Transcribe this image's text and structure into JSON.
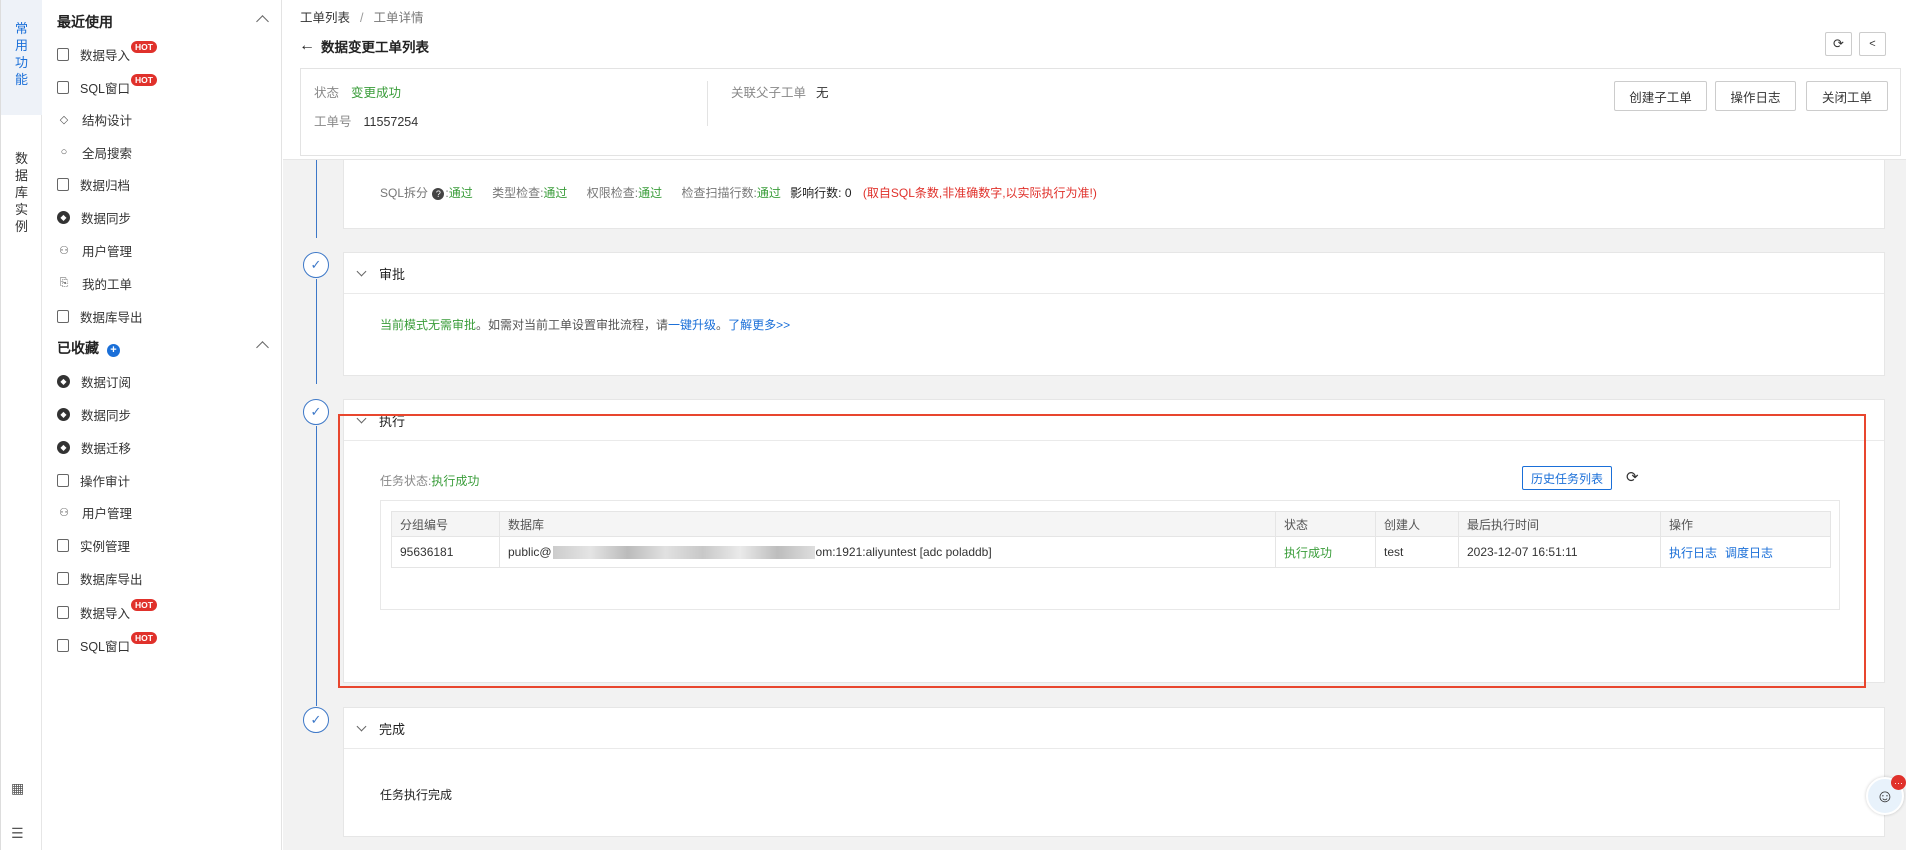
{
  "rail": {
    "active_tab": [
      "常",
      "用",
      "功",
      "能"
    ],
    "second_tab": [
      "数",
      "据",
      "库",
      "实",
      "例"
    ]
  },
  "menu": {
    "recent_title": "最近使用",
    "recent_items": [
      {
        "label": "数据导入",
        "hot": "HOT"
      },
      {
        "label": "SQL窗口",
        "hot": "HOT"
      },
      {
        "label": "结构设计"
      },
      {
        "label": "全局搜索"
      },
      {
        "label": "数据归档"
      },
      {
        "label": "数据同步"
      },
      {
        "label": "用户管理"
      },
      {
        "label": "我的工单"
      },
      {
        "label": "数据库导出"
      }
    ],
    "fav_title": "已收藏",
    "fav_plus": "+",
    "fav_items": [
      {
        "label": "数据订阅"
      },
      {
        "label": "数据同步"
      },
      {
        "label": "数据迁移"
      },
      {
        "label": "操作审计"
      },
      {
        "label": "用户管理"
      },
      {
        "label": "实例管理"
      },
      {
        "label": "数据库导出"
      },
      {
        "label": "数据导入",
        "hot": "HOT"
      },
      {
        "label": "SQL窗口",
        "hot": "HOT"
      }
    ]
  },
  "header": {
    "crumb_root": "工单列表",
    "crumb_sep": "/",
    "crumb_current": "工单详情",
    "back_glyph": "←",
    "title": "数据变更工单列表",
    "refresh_glyph": "⟳",
    "share_glyph": "<"
  },
  "info": {
    "status_label": "状态",
    "status_value": "变更成功",
    "ticket_label": "工单号",
    "ticket_value": "11557254",
    "parent_label": "关联父子工单",
    "parent_value": "无",
    "btn_create_child": "创建子工单",
    "btn_op_log": "操作日志",
    "btn_close": "关闭工单"
  },
  "precheck": {
    "sql_split": "SQL拆分",
    "q": "?",
    "colon": ":",
    "pass": "通过",
    "type_check": "类型检查:",
    "perm_check": "权限检查:",
    "scan_rows": "检查扫描行数:",
    "affected": "影响行数: 0",
    "note": "(取自SQL条数,非准确数字,以实际执行为准!)"
  },
  "approval": {
    "title": "审批",
    "msg_green": "当前模式无需审批",
    "msg_mid": "。如需对当前工单设置审批流程，请",
    "upgrade_link": "一键升级",
    "period": "。",
    "learn_link": "了解更多>>"
  },
  "execute": {
    "title": "执行",
    "task_status_label": "任务状态:",
    "task_status_value": "执行成功",
    "history_btn": "历史任务列表",
    "reload_glyph": "⟳",
    "columns": [
      "分组编号",
      "数据库",
      "状态",
      "创建人",
      "最后执行时间",
      "操作"
    ],
    "row": {
      "group_id": "95636181",
      "db_prefix": "public@",
      "db_suffix": "om:1921:aliyuntest [adc poladdb]",
      "status": "执行成功",
      "creator": "test",
      "last_time": "2023-12-07 16:51:11",
      "action_log": "执行日志",
      "action_schedule": "调度日志"
    }
  },
  "complete": {
    "title": "完成",
    "msg": "任务执行完成"
  },
  "assistant": {
    "glyph": "☺",
    "badge": "···"
  },
  "colors": {
    "accent": "#1a6fd8",
    "success": "#3a9d3a",
    "danger": "#e0312b",
    "highlight": "#e8462e"
  }
}
